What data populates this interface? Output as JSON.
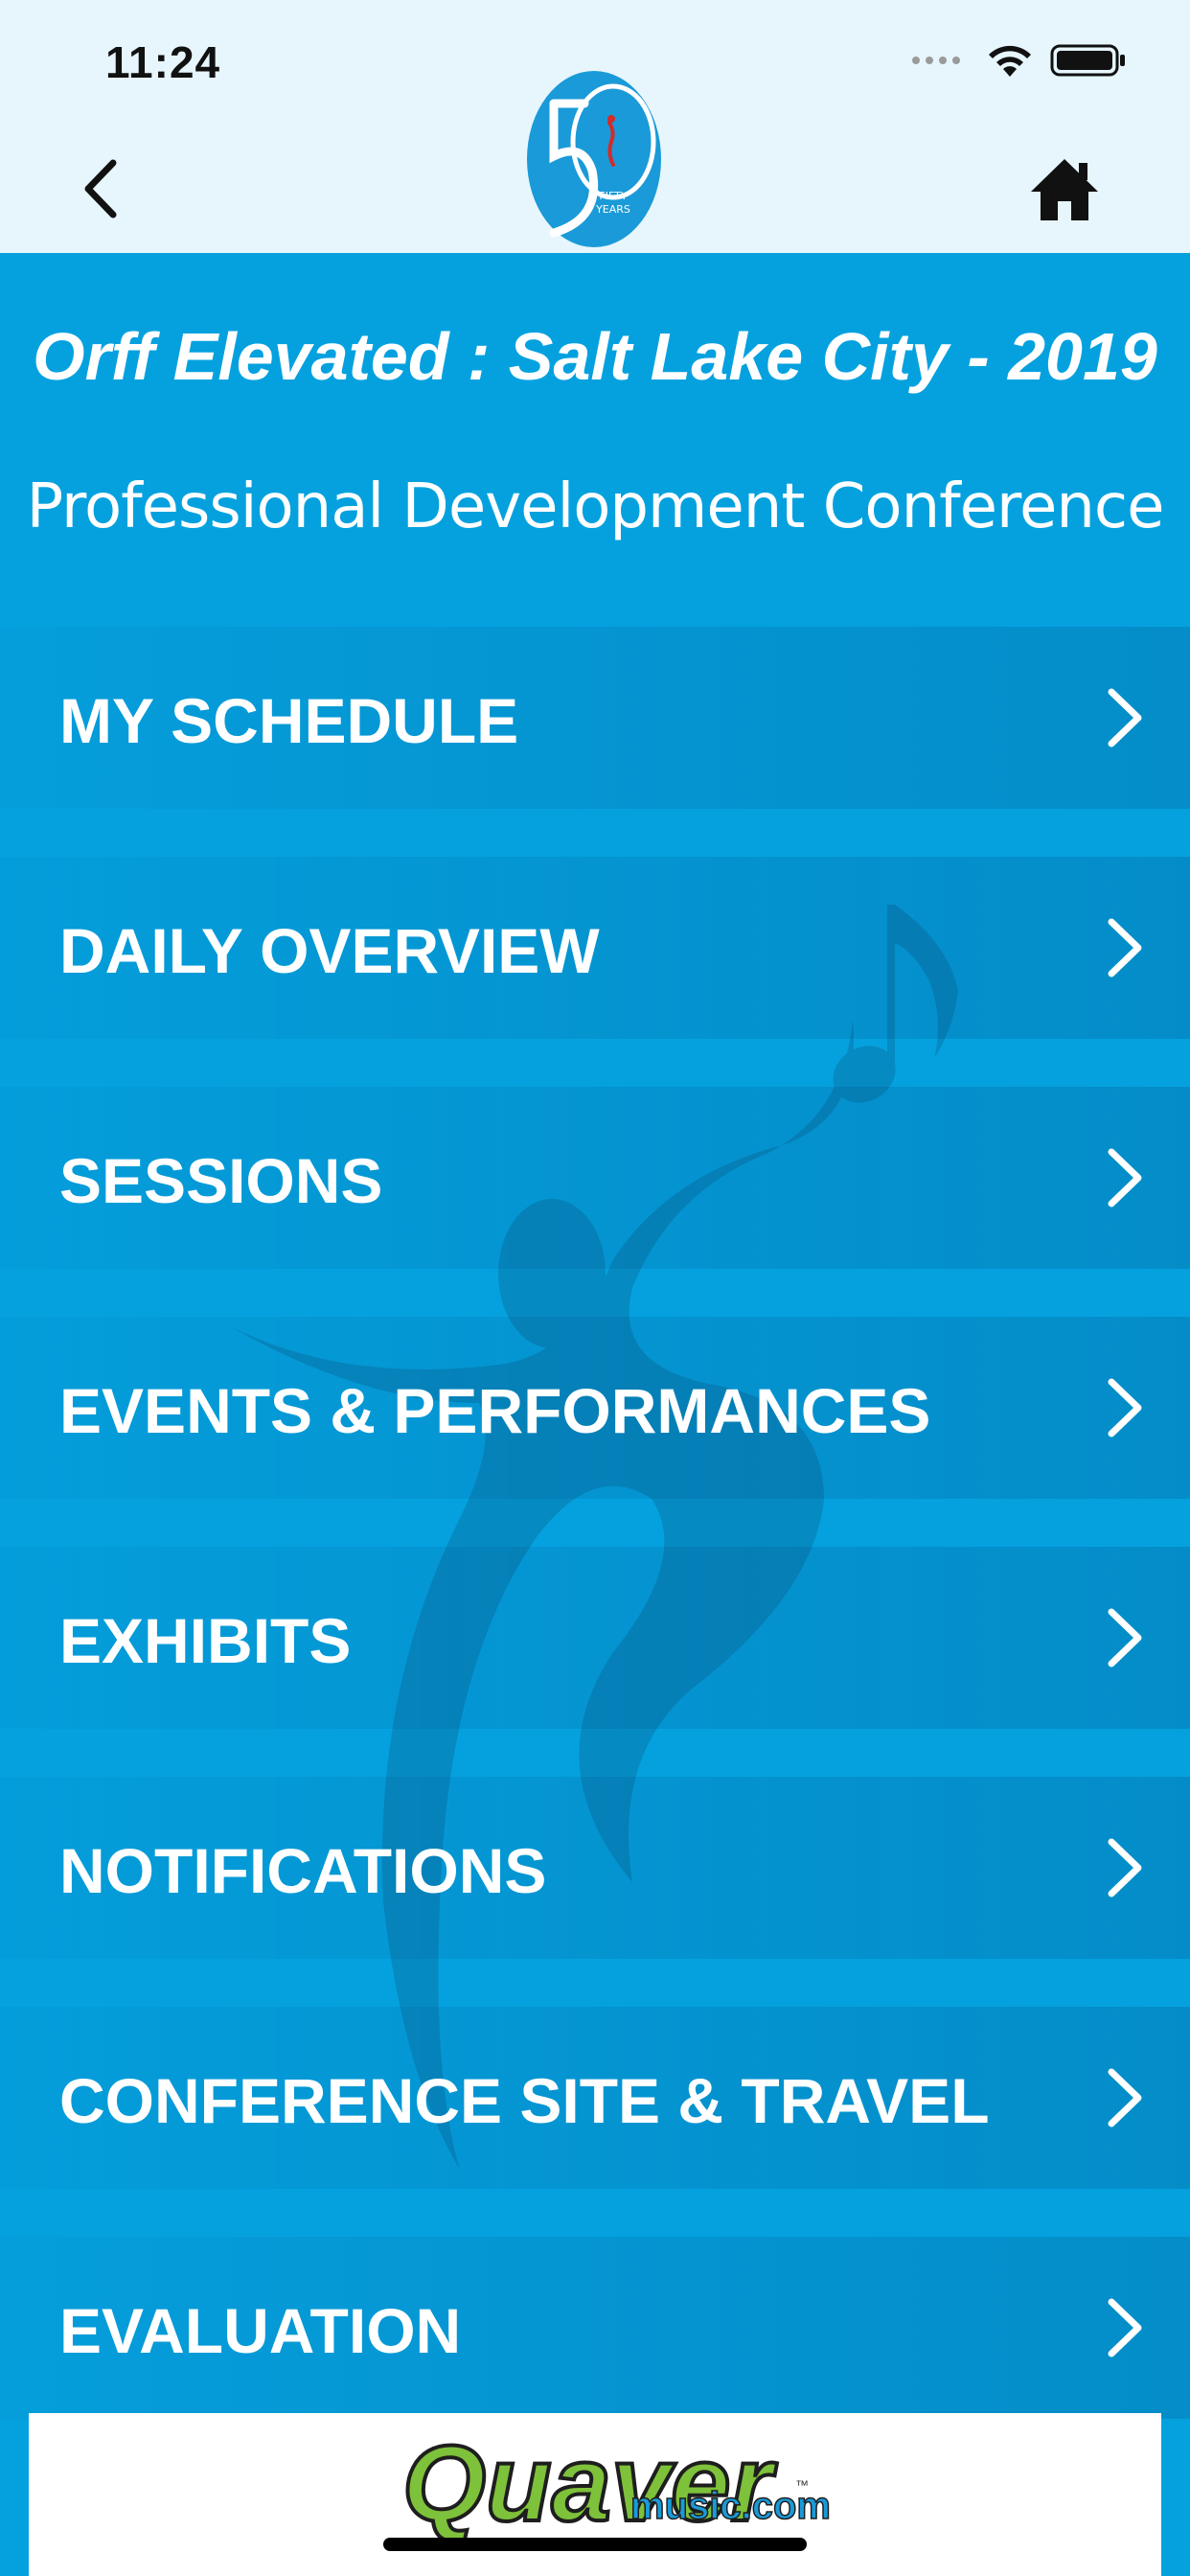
{
  "status_bar": {
    "time": "11:24"
  },
  "nav": {
    "back_icon": "chevron-left-icon",
    "home_icon": "home-icon",
    "logo_text": "FIFTY YEARS",
    "logo_number": "50"
  },
  "conference": {
    "title": "Orff Elevated : Salt Lake City - 2019",
    "subtitle": "Professional Development Conference"
  },
  "menu": {
    "items": [
      {
        "label": "MY SCHEDULE"
      },
      {
        "label": "DAILY OVERVIEW"
      },
      {
        "label": "SESSIONS"
      },
      {
        "label": "EVENTS & PERFORMANCES"
      },
      {
        "label": "EXHIBITS"
      },
      {
        "label": "NOTIFICATIONS"
      },
      {
        "label": "CONFERENCE SITE & TRAVEL"
      },
      {
        "label": "EVALUATION"
      }
    ]
  },
  "ad": {
    "brand": "Quaver",
    "domain": "music.com",
    "trademark": "™"
  },
  "colors": {
    "accent": "#05a1df",
    "topbar": "#e6f6fc",
    "logo_blue": "#1a9ad8",
    "logo_red": "#d42a2a",
    "ad_green": "#7ec13a"
  }
}
